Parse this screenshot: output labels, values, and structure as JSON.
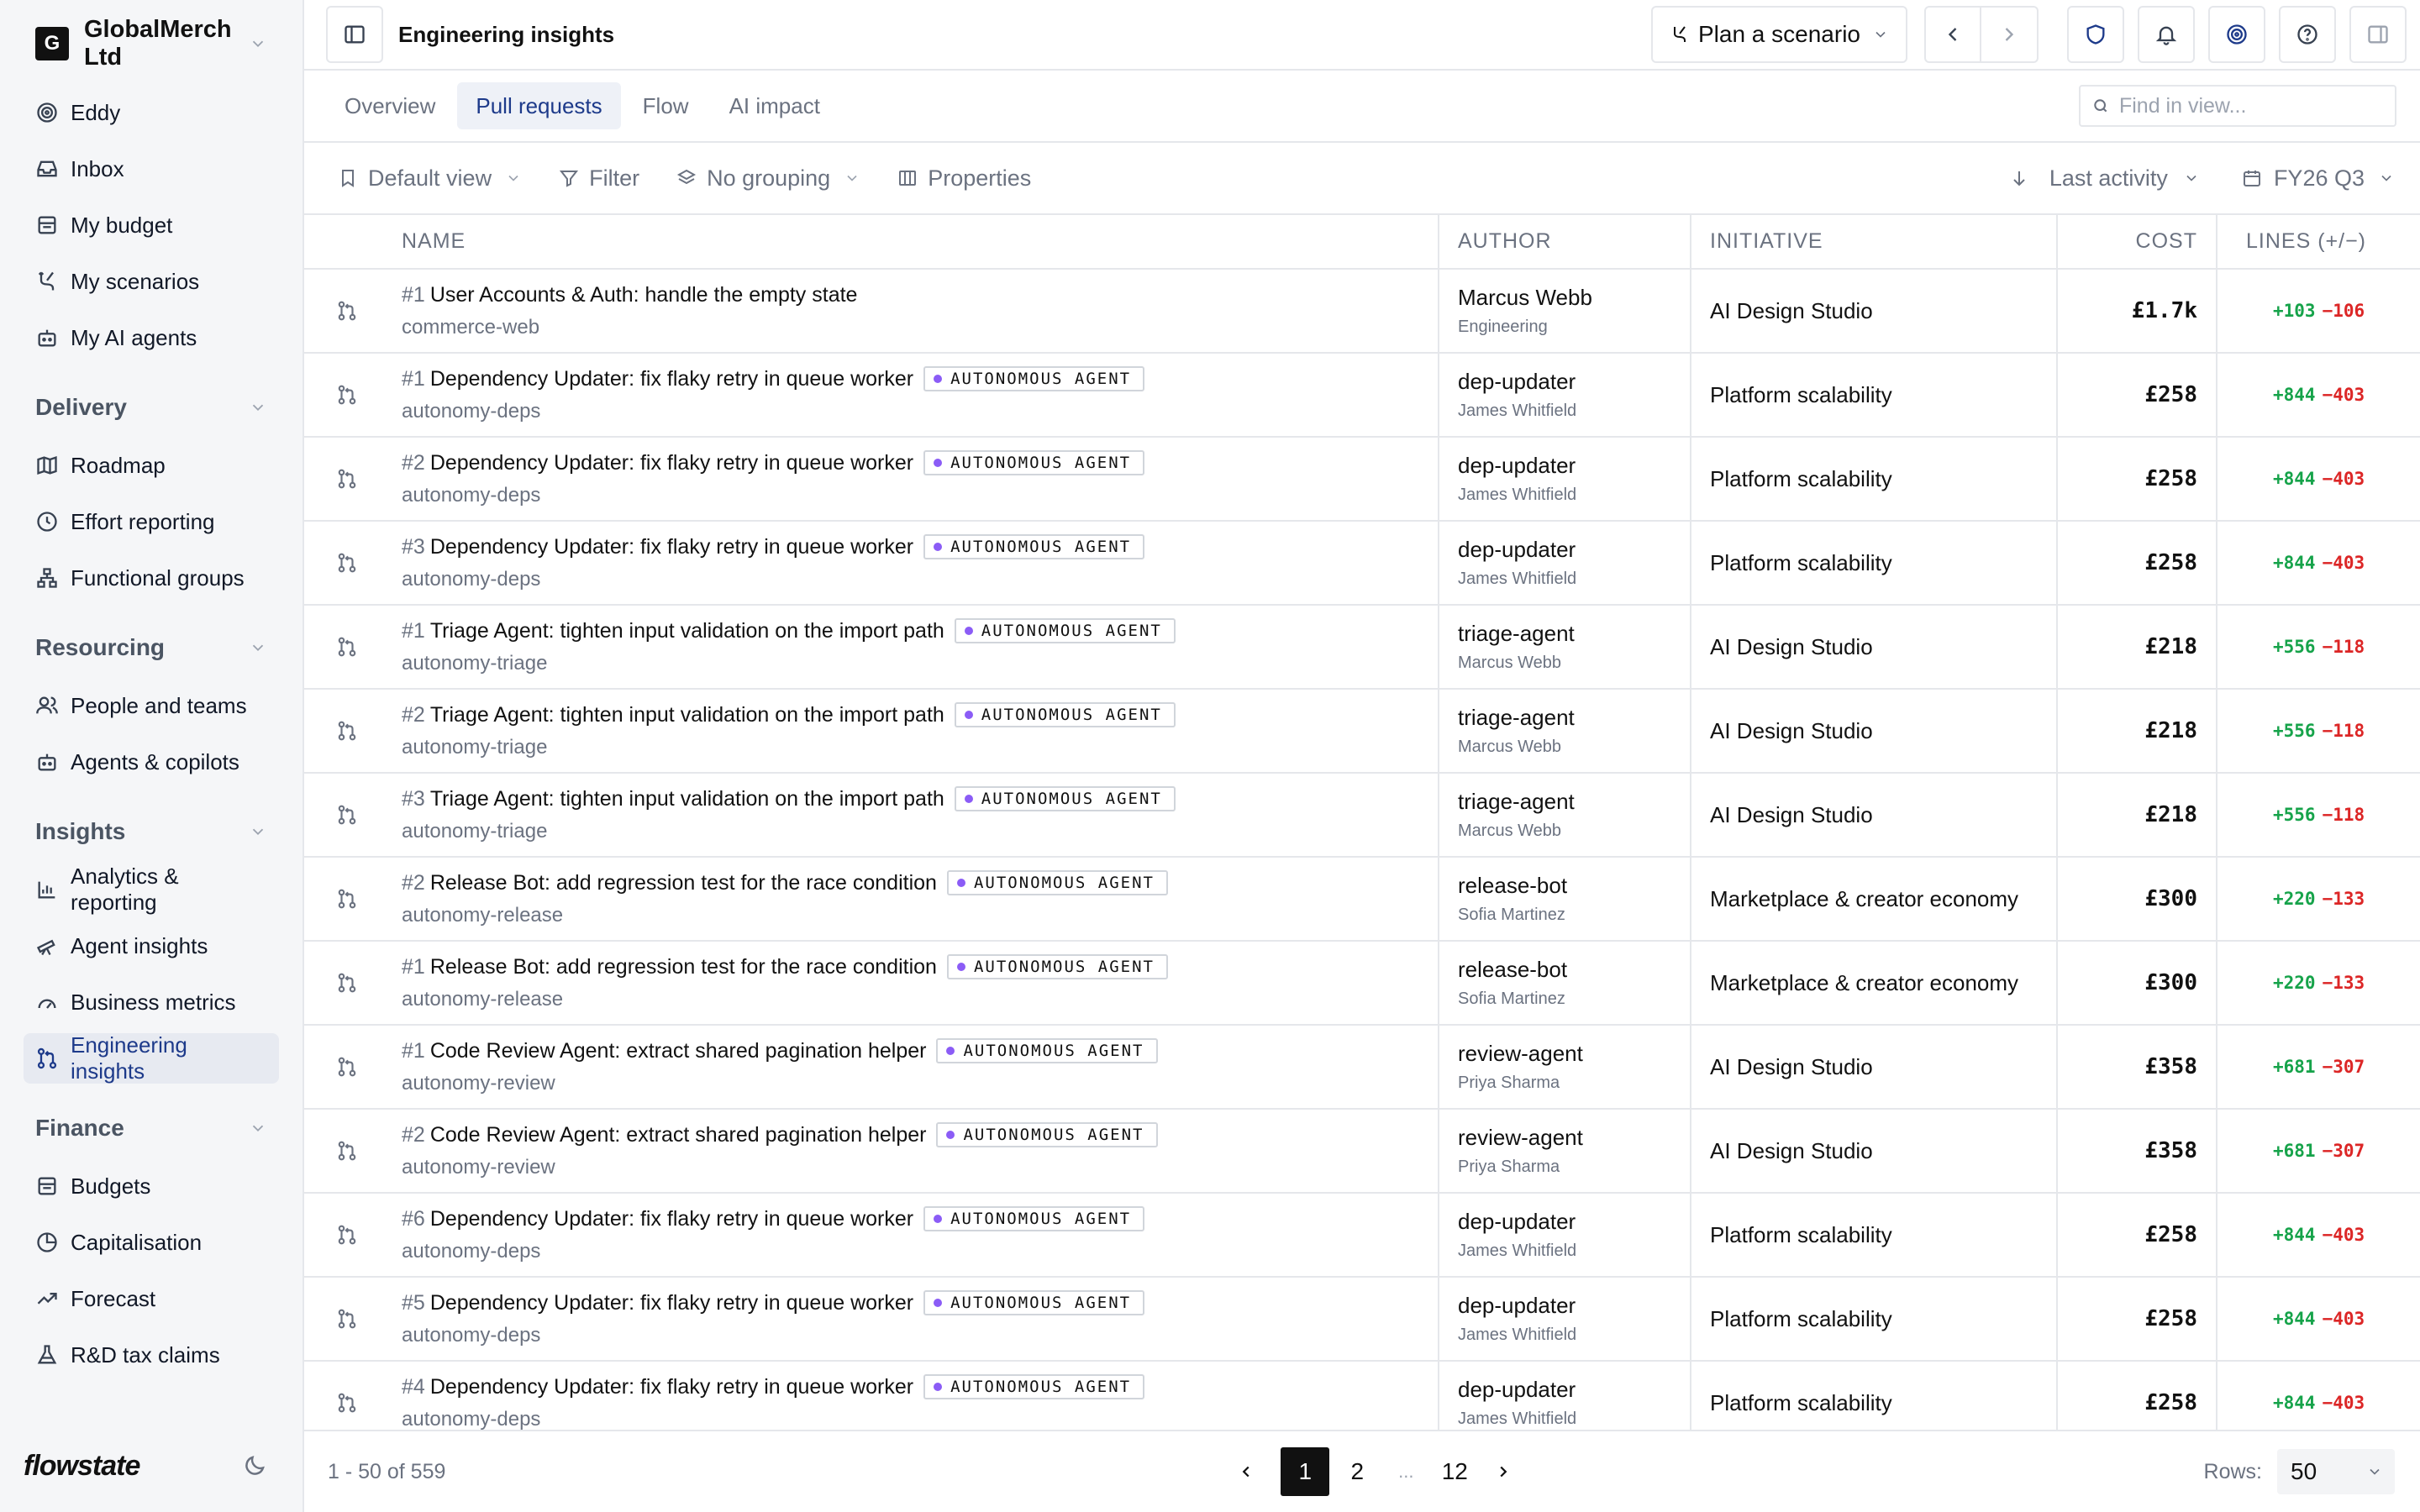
{
  "sidebar": {
    "org": {
      "initial": "G",
      "name": "GlobalMerch Ltd"
    },
    "top_items": [
      {
        "label": "Eddy"
      },
      {
        "label": "Inbox"
      },
      {
        "label": "My budget"
      },
      {
        "label": "My scenarios"
      },
      {
        "label": "My AI agents"
      }
    ],
    "sections": [
      {
        "title": "Delivery",
        "items": [
          {
            "label": "Roadmap"
          },
          {
            "label": "Effort reporting"
          },
          {
            "label": "Functional groups"
          }
        ]
      },
      {
        "title": "Resourcing",
        "items": [
          {
            "label": "People and teams"
          },
          {
            "label": "Agents & copilots"
          }
        ]
      },
      {
        "title": "Insights",
        "items": [
          {
            "label": "Analytics & reporting"
          },
          {
            "label": "Agent insights"
          },
          {
            "label": "Business metrics"
          },
          {
            "label": "Engineering insights"
          }
        ]
      },
      {
        "title": "Finance",
        "items": [
          {
            "label": "Budgets"
          },
          {
            "label": "Capitalisation"
          },
          {
            "label": "Forecast"
          },
          {
            "label": "R&D tax claims"
          }
        ]
      }
    ],
    "brand": "flowstate"
  },
  "topbar": {
    "title": "Engineering insights",
    "scenario_label": "Plan a scenario"
  },
  "tabs": [
    "Overview",
    "Pull requests",
    "Flow",
    "AI impact"
  ],
  "active_tab": "Pull requests",
  "search": {
    "placeholder": "Find in view...",
    "value": ""
  },
  "toolbar": {
    "view": "Default view",
    "filter": "Filter",
    "grouping": "No grouping",
    "properties": "Properties",
    "sort": "Last activity",
    "period": "FY26 Q3"
  },
  "table": {
    "columns": {
      "name": "NAME",
      "author": "AUTHOR",
      "initiative": "INITIATIVE",
      "cost": "COST",
      "lines": "LINES (+/−)"
    },
    "badge_label": "AUTONOMOUS AGENT",
    "rows": [
      {
        "num": "#1",
        "title": "User Accounts & Auth: handle the empty state",
        "agent": false,
        "repo": "commerce-web",
        "author": "Marcus Webb",
        "author_sub": "Engineering",
        "initiative": "AI Design Studio",
        "cost": "£1.7k",
        "plus": "+103",
        "minus": "−106"
      },
      {
        "num": "#1",
        "title": "Dependency Updater: fix flaky retry in queue worker",
        "agent": true,
        "repo": "autonomy-deps",
        "author": "dep-updater",
        "author_sub": "James Whitfield",
        "initiative": "Platform scalability",
        "cost": "£258",
        "plus": "+844",
        "minus": "−403"
      },
      {
        "num": "#2",
        "title": "Dependency Updater: fix flaky retry in queue worker",
        "agent": true,
        "repo": "autonomy-deps",
        "author": "dep-updater",
        "author_sub": "James Whitfield",
        "initiative": "Platform scalability",
        "cost": "£258",
        "plus": "+844",
        "minus": "−403"
      },
      {
        "num": "#3",
        "title": "Dependency Updater: fix flaky retry in queue worker",
        "agent": true,
        "repo": "autonomy-deps",
        "author": "dep-updater",
        "author_sub": "James Whitfield",
        "initiative": "Platform scalability",
        "cost": "£258",
        "plus": "+844",
        "minus": "−403"
      },
      {
        "num": "#1",
        "title": "Triage Agent: tighten input validation on the import path",
        "agent": true,
        "repo": "autonomy-triage",
        "author": "triage-agent",
        "author_sub": "Marcus Webb",
        "initiative": "AI Design Studio",
        "cost": "£218",
        "plus": "+556",
        "minus": "−118"
      },
      {
        "num": "#2",
        "title": "Triage Agent: tighten input validation on the import path",
        "agent": true,
        "repo": "autonomy-triage",
        "author": "triage-agent",
        "author_sub": "Marcus Webb",
        "initiative": "AI Design Studio",
        "cost": "£218",
        "plus": "+556",
        "minus": "−118"
      },
      {
        "num": "#3",
        "title": "Triage Agent: tighten input validation on the import path",
        "agent": true,
        "repo": "autonomy-triage",
        "author": "triage-agent",
        "author_sub": "Marcus Webb",
        "initiative": "AI Design Studio",
        "cost": "£218",
        "plus": "+556",
        "minus": "−118"
      },
      {
        "num": "#2",
        "title": "Release Bot: add regression test for the race condition",
        "agent": true,
        "repo": "autonomy-release",
        "author": "release-bot",
        "author_sub": "Sofia Martinez",
        "initiative": "Marketplace & creator economy",
        "cost": "£300",
        "plus": "+220",
        "minus": "−133"
      },
      {
        "num": "#1",
        "title": "Release Bot: add regression test for the race condition",
        "agent": true,
        "repo": "autonomy-release",
        "author": "release-bot",
        "author_sub": "Sofia Martinez",
        "initiative": "Marketplace & creator economy",
        "cost": "£300",
        "plus": "+220",
        "minus": "−133"
      },
      {
        "num": "#1",
        "title": "Code Review Agent: extract shared pagination helper",
        "agent": true,
        "repo": "autonomy-review",
        "author": "review-agent",
        "author_sub": "Priya Sharma",
        "initiative": "AI Design Studio",
        "cost": "£358",
        "plus": "+681",
        "minus": "−307"
      },
      {
        "num": "#2",
        "title": "Code Review Agent: extract shared pagination helper",
        "agent": true,
        "repo": "autonomy-review",
        "author": "review-agent",
        "author_sub": "Priya Sharma",
        "initiative": "AI Design Studio",
        "cost": "£358",
        "plus": "+681",
        "minus": "−307"
      },
      {
        "num": "#6",
        "title": "Dependency Updater: fix flaky retry in queue worker",
        "agent": true,
        "repo": "autonomy-deps",
        "author": "dep-updater",
        "author_sub": "James Whitfield",
        "initiative": "Platform scalability",
        "cost": "£258",
        "plus": "+844",
        "minus": "−403"
      },
      {
        "num": "#5",
        "title": "Dependency Updater: fix flaky retry in queue worker",
        "agent": true,
        "repo": "autonomy-deps",
        "author": "dep-updater",
        "author_sub": "James Whitfield",
        "initiative": "Platform scalability",
        "cost": "£258",
        "plus": "+844",
        "minus": "−403"
      },
      {
        "num": "#4",
        "title": "Dependency Updater: fix flaky retry in queue worker",
        "agent": true,
        "repo": "autonomy-deps",
        "author": "dep-updater",
        "author_sub": "James Whitfield",
        "initiative": "Platform scalability",
        "cost": "£258",
        "plus": "+844",
        "minus": "−403"
      }
    ]
  },
  "footer": {
    "range": "1 - 50 of 559",
    "pages": [
      "1",
      "2",
      "...",
      "12"
    ],
    "current_page": "1",
    "rows_label": "Rows:",
    "rows_value": "50"
  },
  "colors": {
    "accent": "#1d3a8a",
    "agent_dot": "#8b5cf6",
    "added": "#16a34a",
    "removed": "#dc2626"
  }
}
